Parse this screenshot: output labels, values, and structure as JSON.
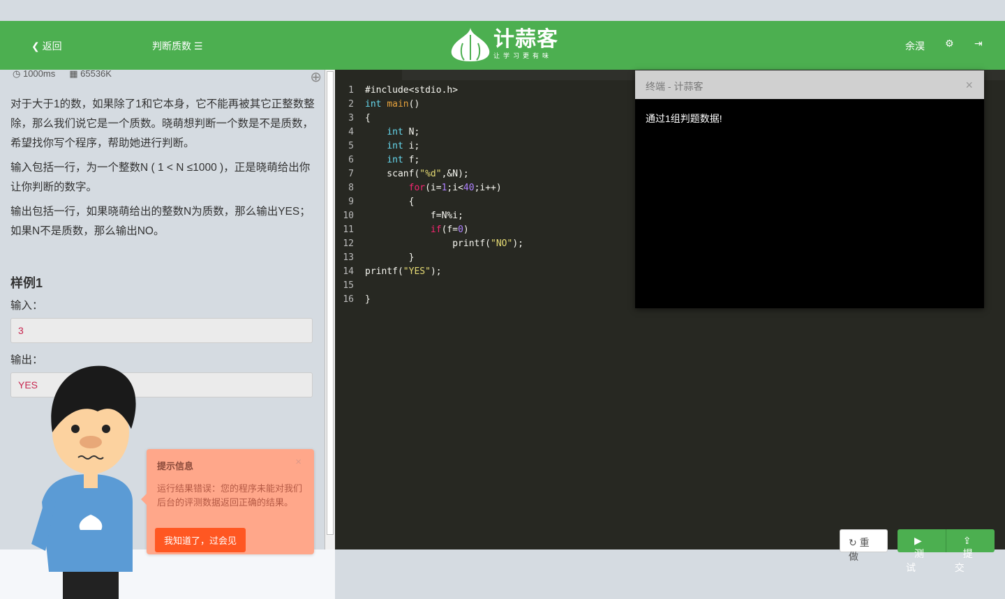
{
  "header": {
    "back": "返回",
    "problem_title": "判断质数",
    "logo_text": "计蒜客",
    "logo_slogan": "让学习更有味",
    "user": "余淏"
  },
  "problem": {
    "time_limit": "1000ms",
    "memory_limit": "65536K",
    "description": [
      "对于大于1的数，如果除了1和它本身，它不能再被其它正整数整除，那么我们说它是一个质数。晓萌想判断一个数是不是质数，希望找你写个程序，帮助她进行判断。",
      "输入包括一行，为一个整数N ( 1 < N ≤1000 )，正是晓萌给出你让你判断的数字。",
      "输出包括一行，如果晓萌给出的整数N为质数，那么输出YES；如果N不是质数，那么输出NO。"
    ],
    "sample_title": "样例1",
    "input_label": "输入：",
    "input_value": "3",
    "output_label": "输出：",
    "output_value": "YES"
  },
  "editor": {
    "lines": [
      [
        [
          "",
          "#include<stdio.h>"
        ]
      ],
      [
        [
          "kt",
          "int"
        ],
        [
          "",
          " "
        ],
        [
          "fn",
          "main"
        ],
        [
          "",
          "()"
        ]
      ],
      [
        [
          "",
          "{"
        ]
      ],
      [
        [
          "",
          "    "
        ],
        [
          "kt",
          "int"
        ],
        [
          "",
          " N;"
        ]
      ],
      [
        [
          "",
          "    "
        ],
        [
          "kt",
          "int"
        ],
        [
          "",
          " i;"
        ]
      ],
      [
        [
          "",
          "    "
        ],
        [
          "kt",
          "int"
        ],
        [
          "",
          " f;"
        ]
      ],
      [
        [
          "",
          "    scanf("
        ],
        [
          "st",
          "\"%d\""
        ],
        [
          "",
          ",&N);"
        ]
      ],
      [
        [
          "",
          "        "
        ],
        [
          "kw",
          "for"
        ],
        [
          "",
          "(i="
        ],
        [
          "nu",
          "1"
        ],
        [
          "",
          ";i<"
        ],
        [
          "nu",
          "40"
        ],
        [
          "",
          ";i++)"
        ]
      ],
      [
        [
          "",
          "        {"
        ]
      ],
      [
        [
          "",
          "            f=N%i;"
        ]
      ],
      [
        [
          "",
          "            "
        ],
        [
          "kw",
          "if"
        ],
        [
          "",
          "(f="
        ],
        [
          "nu",
          "0"
        ],
        [
          "",
          ")"
        ]
      ],
      [
        [
          "",
          "                printf("
        ],
        [
          "st",
          "\"NO\""
        ],
        [
          "",
          ");"
        ]
      ],
      [
        [
          "",
          "        }"
        ]
      ],
      [
        [
          "",
          "printf("
        ],
        [
          "st",
          "\"YES\""
        ],
        [
          "",
          ");"
        ]
      ],
      [
        [
          "",
          ""
        ]
      ],
      [
        [
          "",
          "}"
        ]
      ]
    ]
  },
  "terminal": {
    "title": "终端 - 计蒜客",
    "output": "通过1组判题数据!"
  },
  "buttons": {
    "redo": "重做",
    "test": "测试",
    "submit": "提交"
  },
  "tip": {
    "title": "提示信息",
    "message": "运行结果错误：您的程序未能对我们后台的评测数据返回正确的结果。",
    "dismiss": "我知道了，过会见"
  },
  "colors": {
    "brand": "#4caf50",
    "editor_bg": "#272822",
    "tip_bg": "#ffa78a",
    "tip_button": "#ff5722"
  }
}
